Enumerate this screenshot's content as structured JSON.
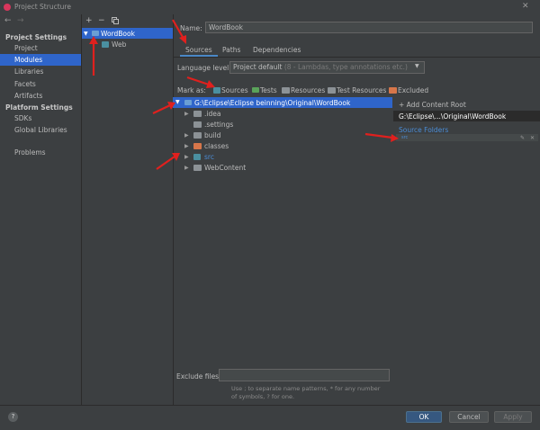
{
  "window": {
    "title": "Project Structure",
    "close_glyph": "✕"
  },
  "nav": {
    "back_glyph": "←",
    "forward_glyph": "→",
    "project_settings_heading": "Project Settings",
    "project_settings_items": [
      {
        "label": "Project",
        "selected": false
      },
      {
        "label": "Modules",
        "selected": true
      },
      {
        "label": "Libraries",
        "selected": false
      },
      {
        "label": "Facets",
        "selected": false
      },
      {
        "label": "Artifacts",
        "selected": false
      }
    ],
    "platform_settings_heading": "Platform Settings",
    "platform_settings_items": [
      {
        "label": "SDKs"
      },
      {
        "label": "Global Libraries"
      }
    ],
    "problems_label": "Problems"
  },
  "modules_panel": {
    "add_glyph": "+",
    "remove_glyph": "−",
    "copy_icon": "copy-icon",
    "tree": [
      {
        "label": "WordBook",
        "expanded": true,
        "selected": true
      },
      {
        "label": "Web",
        "child": true
      }
    ]
  },
  "module_editor": {
    "name_label": "Name:",
    "name_value": "WordBook",
    "tabs": [
      {
        "label": "Sources",
        "active": true
      },
      {
        "label": "Paths",
        "active": false
      },
      {
        "label": "Dependencies",
        "active": false
      }
    ],
    "language_level_label": "Language level:",
    "language_level_value": "Project default",
    "language_level_hint": "(8 - Lambdas, type annotations etc.)",
    "mark_as_label": "Mark as:",
    "mark_as_items": [
      {
        "label": "Sources",
        "color": "#4a8fa0"
      },
      {
        "label": "Tests",
        "color": "#5aa35a"
      },
      {
        "label": "Resources",
        "color": "#8c9296"
      },
      {
        "label": "Test Resources",
        "color": "#8c9296"
      },
      {
        "label": "Excluded",
        "color": "#d7764a"
      }
    ],
    "content_root_path": "G:\\Eclipse\\Eclipse beinning\\Original\\WordBook",
    "folders": [
      {
        "label": ".idea",
        "expandable": true
      },
      {
        "label": ".settings",
        "expandable": false
      },
      {
        "label": "build",
        "expandable": true
      },
      {
        "label": "classes",
        "expandable": true,
        "excluded": true
      },
      {
        "label": "src",
        "expandable": true,
        "source": true
      },
      {
        "label": "WebContent",
        "expandable": true
      }
    ],
    "exclude_files_label": "Exclude files:",
    "exclude_files_value": "",
    "exclude_files_hint": "Use ; to separate name patterns, * for any number of symbols, ? for one."
  },
  "content_root_panel": {
    "add_content_root_label": "+ Add Content Root",
    "root_path_short": "G:\\Eclipse\\...\\Original\\WordBook",
    "source_folders_heading": "Source Folders",
    "source_folder_entry": "src"
  },
  "dialog_buttons": {
    "help_glyph": "?",
    "ok": "OK",
    "cancel": "Cancel",
    "apply": "Apply"
  }
}
